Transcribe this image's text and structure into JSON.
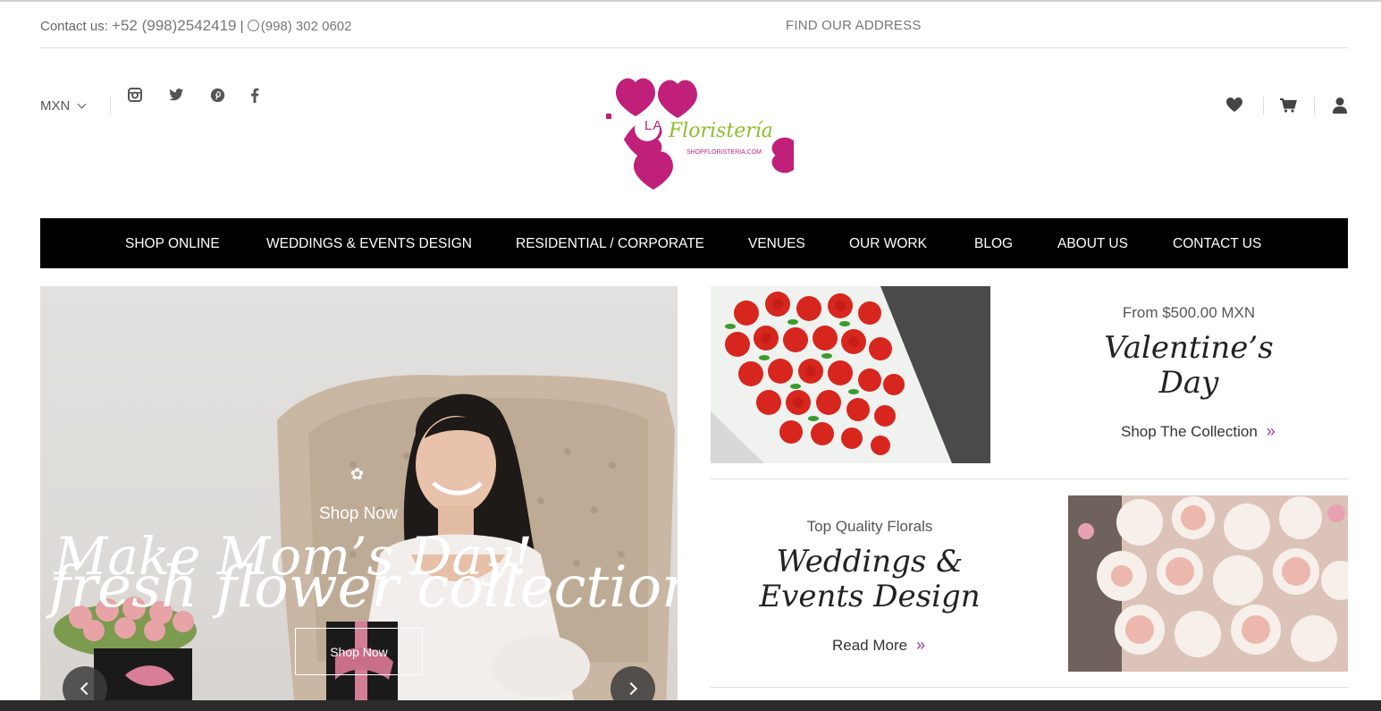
{
  "contact": {
    "label": "Contact us:",
    "phone": "+52 (998)2542419",
    "separator": "|",
    "whatsapp": "(998) 302 0602",
    "find_address": "FIND OUR ADDRESS"
  },
  "header": {
    "currency": "MXN",
    "social_icons": [
      "instagram-icon",
      "twitter-icon",
      "pinterest-icon",
      "facebook-icon"
    ],
    "right_icons": [
      "heart-icon",
      "cart-icon",
      "user-icon"
    ],
    "logo": {
      "prefix": "LA",
      "name": "Floristería",
      "url": "SHOPFLORISTERIA.COM"
    }
  },
  "nav": {
    "items": [
      "SHOP ONLINE",
      "WEDDINGS & EVENTS DESIGN",
      "RESIDENTIAL / CORPORATE",
      "VENUES",
      "OUR WORK",
      "BLOG",
      "ABOUT US",
      "CONTACT US"
    ]
  },
  "hero": {
    "small_link": "Shop Now",
    "title_a": "Make Mom’s Day!",
    "title_b": "fresh flower collection",
    "button": "Shop Now"
  },
  "promos": {
    "valentines": {
      "subtitle": "From $500.00 MXN",
      "title_1": "Valentine’s",
      "title_2": "Day",
      "link": "Shop The Collection"
    },
    "weddings": {
      "subtitle": "Top Quality Florals",
      "title_1": "Weddings &",
      "title_2": "Events Design",
      "link": "Read More"
    }
  },
  "colors": {
    "brand_pink": "#c0207a",
    "brand_green": "#8cbd2b",
    "nav_bg": "#000000",
    "accent_chevron": "#9b3a8c"
  }
}
